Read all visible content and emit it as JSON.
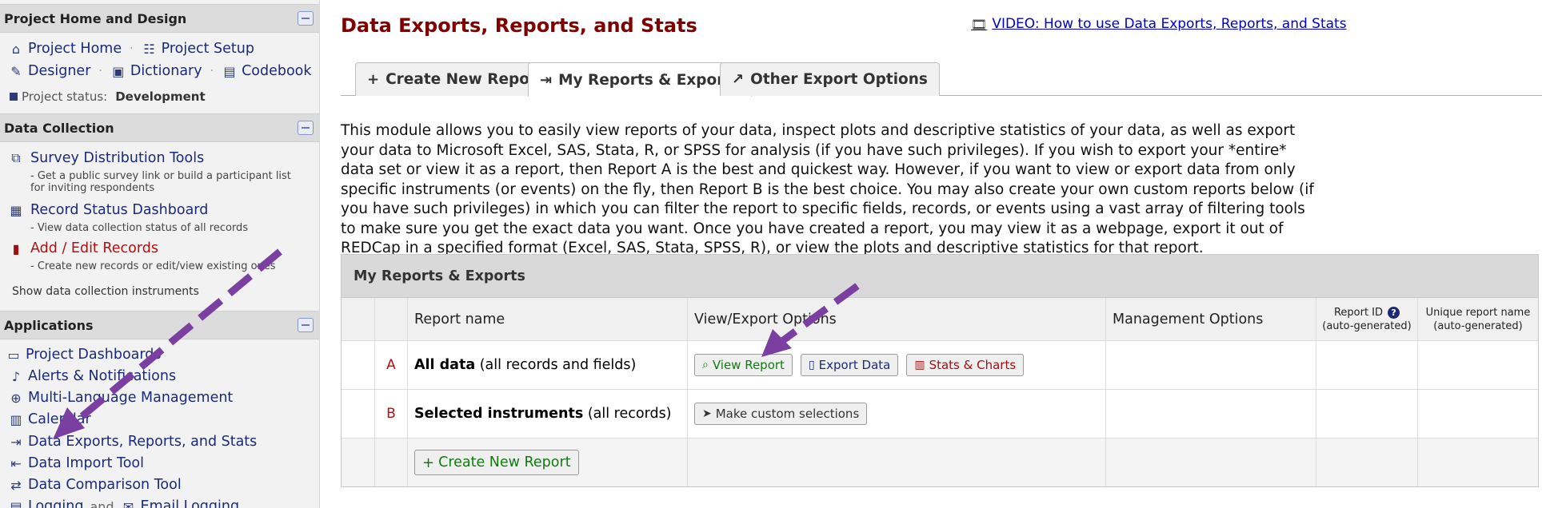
{
  "sidebar": {
    "project_section": {
      "title": "Project Home and Design",
      "links_row1": [
        "Project Home",
        "Project Setup"
      ],
      "links_row2": [
        "Designer",
        "Dictionary",
        "Codebook"
      ],
      "separator": "·",
      "status_label": "Project status:",
      "status_value": "Development"
    },
    "collection_section": {
      "title": "Data Collection",
      "items": [
        {
          "label": "Survey Distribution Tools",
          "desc": "- Get a public survey link or build a participant list for inviting respondents",
          "icon": "survey-tools-icon"
        },
        {
          "label": "Record Status Dashboard",
          "desc": "- View data collection status of all records",
          "icon": "grid-icon"
        },
        {
          "label": "Add / Edit Records",
          "desc": "- Create new records or edit/view existing ones",
          "icon": "file-edit-icon"
        }
      ],
      "show_instruments": "Show data collection instruments"
    },
    "applications_section": {
      "title": "Applications",
      "items": [
        {
          "label": "Project Dashboards",
          "icon": "dashboard-icon"
        },
        {
          "label": "Alerts & Notifications",
          "icon": "bell-icon"
        },
        {
          "label": "Multi-Language Management",
          "icon": "globe-icon"
        },
        {
          "label": "Calendar",
          "icon": "calendar-icon"
        },
        {
          "label": "Data Exports, Reports, and Stats",
          "icon": "file-export-icon"
        },
        {
          "label": "Data Import Tool",
          "icon": "file-import-icon"
        },
        {
          "label": "Data Comparison Tool",
          "icon": "compare-icon"
        },
        {
          "label": "Logging",
          "icon": "log-icon"
        },
        {
          "label": "Email Logging",
          "icon": "email-log-icon"
        }
      ],
      "logging_and": "and"
    }
  },
  "main": {
    "title": "Data Exports, Reports, and Stats",
    "video_link": "VIDEO: How to use Data Exports, Reports, and Stats",
    "tabs": [
      {
        "label": "Create New Report",
        "icon": "plus-icon"
      },
      {
        "label": "My Reports & Exports",
        "icon": "file-export-icon"
      },
      {
        "label": "Other Export Options",
        "icon": "share-icon"
      }
    ],
    "description": "This module allows you to easily view reports of your data, inspect plots and descriptive statistics of your data, as well as export your data to Microsoft Excel, SAS, Stata, R, or SPSS for analysis (if you have such privileges). If you wish to export your *entire* data set or view it as a report, then Report A is the best and quickest way. However, if you want to view or export data from only specific instruments (or events) on the fly, then Report B is the best choice. You may also create your own custom reports below (if you have such privileges) in which you can filter the report to specific fields, records, or events using a vast array of filtering tools to make sure you get the exact data you want. Once you have created a report, you may view it as a webpage, export it out of REDCap in a specified format (Excel, SAS, Stata, SPSS, R), or view the plots and descriptive statistics for that report.",
    "table": {
      "title": "My Reports & Exports",
      "headers": {
        "report_name": "Report name",
        "view_export": "View/Export Options",
        "management": "Management Options",
        "report_id": "Report ID",
        "report_id_sub": "(auto-generated)",
        "unique_name": "Unique report name",
        "unique_name_sub": "(auto-generated)"
      },
      "rows": [
        {
          "letter": "A",
          "name_bold": "All data",
          "name_rest": "(all records and fields)"
        },
        {
          "letter": "B",
          "name_bold": "Selected instruments",
          "name_rest": "(all records)"
        }
      ],
      "buttons": {
        "view_report": "View Report",
        "export_data": "Export Data",
        "stats_charts": "Stats & Charts",
        "custom_selections": "Make custom selections",
        "create_new_report": "Create New Report"
      }
    }
  },
  "colors": {
    "title_red": "#800000",
    "link_blue": "#1a2a7a",
    "button_green": "#117a11",
    "annotation_arrow": "#7a3fa0"
  }
}
